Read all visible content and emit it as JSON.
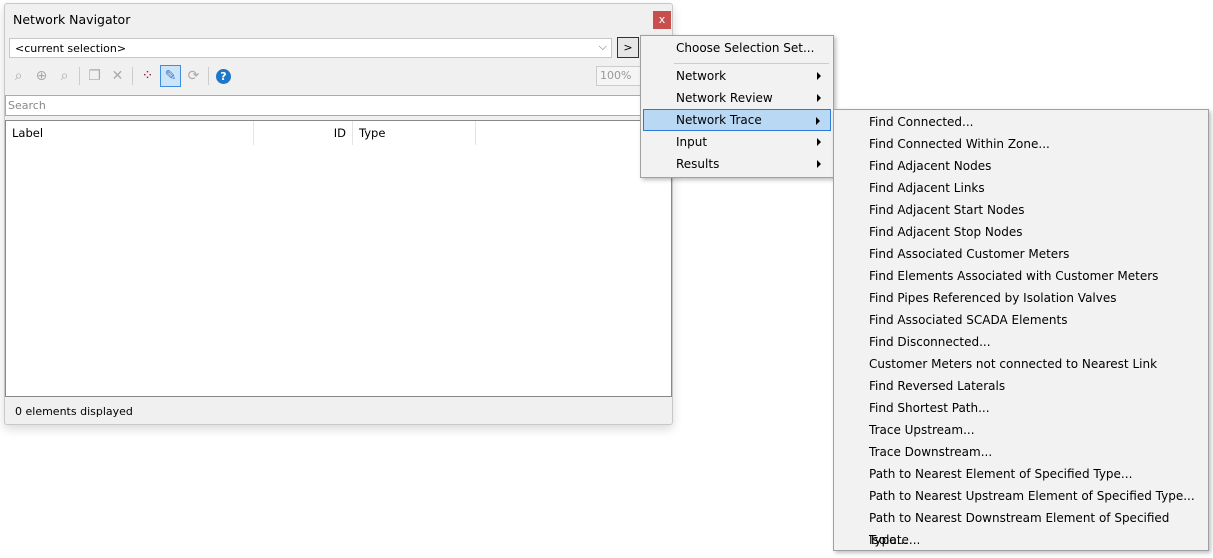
{
  "panel": {
    "title": "Network Navigator",
    "close": "x",
    "selection": "<current selection>",
    "go": ">",
    "zoom": "100%",
    "search_placeholder": "Search",
    "status": "0 elements displayed"
  },
  "columns": [
    "Label",
    "ID",
    "Type"
  ],
  "toolbar_icons": [
    "zoom-previous-icon",
    "zoom-in-icon",
    "zoom-next-icon",
    "copy-icon",
    "delete-icon",
    "select-in-drawing-icon",
    "highlight-pen-icon",
    "refresh-icon",
    "help-icon"
  ],
  "menu": {
    "items": [
      {
        "label": "Choose Selection Set..."
      },
      {
        "label": "Network"
      },
      {
        "label": "Network Review"
      },
      {
        "label": "Network Trace"
      },
      {
        "label": "Input"
      },
      {
        "label": "Results"
      }
    ]
  },
  "submenu": {
    "items": [
      "Find Connected...",
      "Find Connected Within Zone...",
      "Find Adjacent Nodes",
      "Find Adjacent Links",
      "Find Adjacent Start Nodes",
      "Find Adjacent Stop Nodes",
      "Find Associated Customer Meters",
      "Find Elements Associated with Customer Meters",
      "Find Pipes Referenced by Isolation Valves",
      "Find Associated SCADA Elements",
      "Find Disconnected...",
      "Customer Meters not connected to Nearest Link",
      "Find Reversed Laterals",
      "Find Shortest Path...",
      "Trace Upstream...",
      "Trace Downstream...",
      "Path to Nearest Element of Specified Type...",
      "Path to Nearest Upstream Element of Specified Type...",
      "Path to Nearest Downstream Element of Specified Type...",
      "Isolate..."
    ]
  },
  "colors": {
    "highlight": "#b9d8f4",
    "close": "#c94f4f",
    "help": "#1e78c8"
  }
}
